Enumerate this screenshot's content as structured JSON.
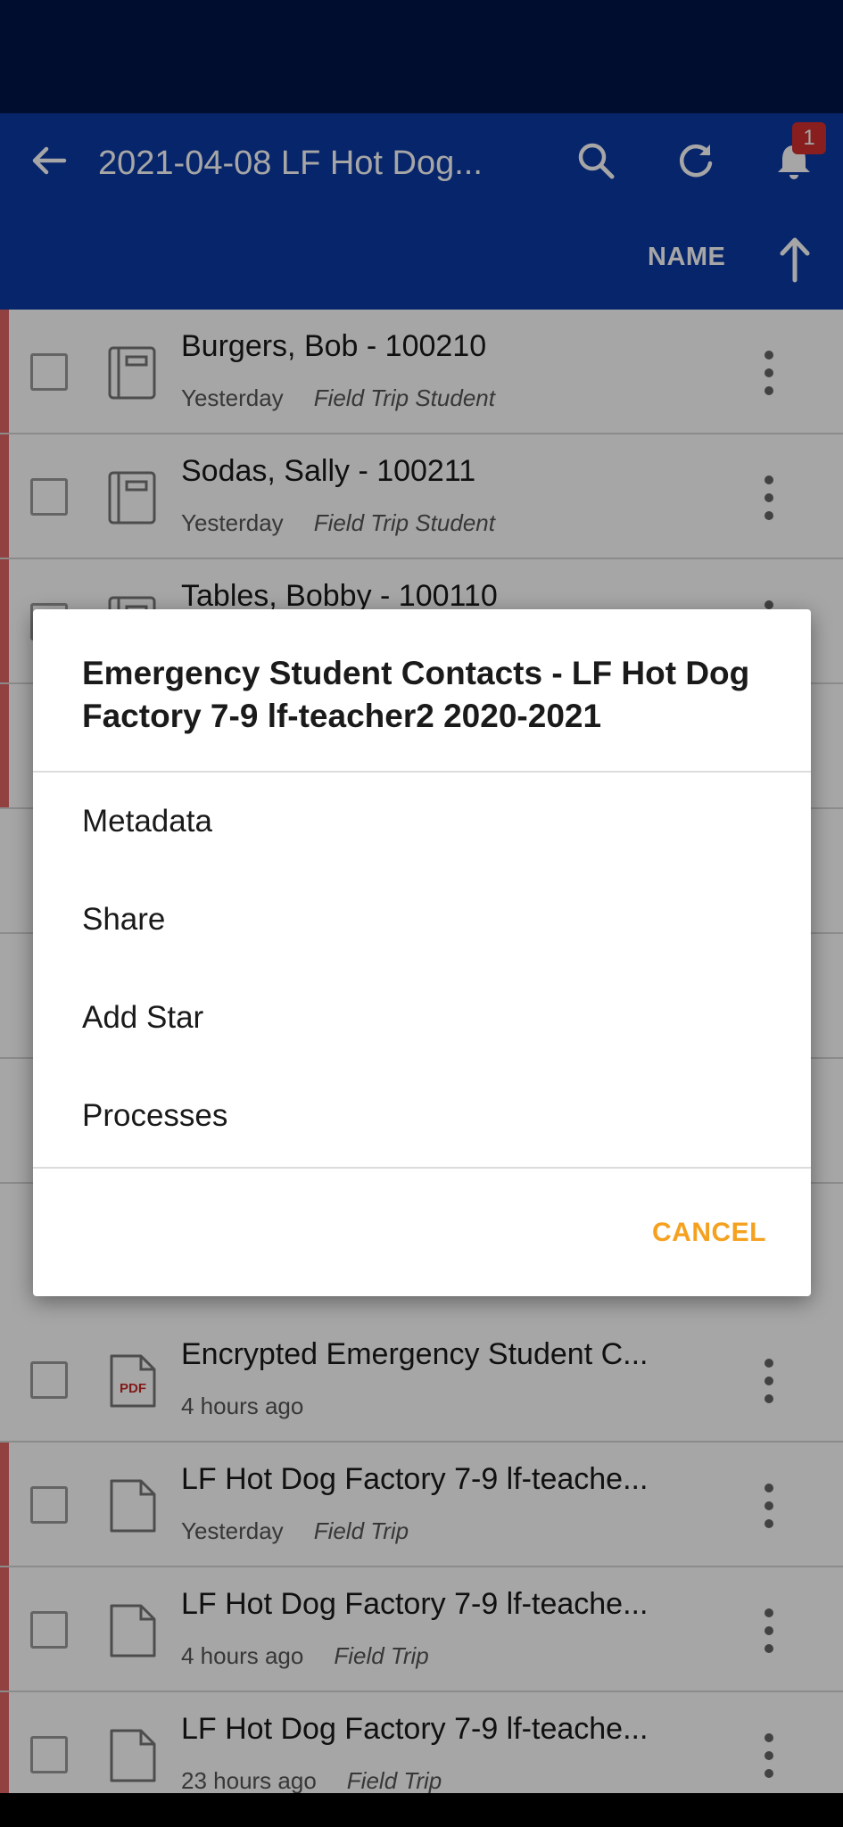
{
  "app_bar": {
    "title": "2021-04-08 LF Hot Dog...",
    "notification_count": "1",
    "sort_label": "NAME"
  },
  "list": {
    "rows": [
      {
        "name": "Burgers, Bob - 100210",
        "time": "Yesterday",
        "tag": "Field Trip Student",
        "icon": "form-icon"
      },
      {
        "name": "Sodas, Sally - 100211",
        "time": "Yesterday",
        "tag": "Field Trip Student",
        "icon": "form-icon"
      },
      {
        "name": "Tables, Bobby - 100110",
        "time": "",
        "tag": "",
        "icon": "form-icon"
      },
      {
        "name": "Encrypted Emergency Student C...",
        "time": "4 hours ago",
        "tag": "",
        "icon": "pdf-icon"
      },
      {
        "name": "LF Hot Dog Factory 7-9 lf-teache...",
        "time": "Yesterday",
        "tag": "Field Trip",
        "icon": "document-icon"
      },
      {
        "name": "LF Hot Dog Factory 7-9 lf-teache...",
        "time": "4 hours ago",
        "tag": "Field Trip",
        "icon": "document-icon"
      },
      {
        "name": "LF Hot Dog Factory 7-9 lf-teache...",
        "time": "23 hours ago",
        "tag": "Field Trip",
        "icon": "document-icon"
      }
    ]
  },
  "dialog": {
    "title": "Emergency Student Contacts - LF Hot Dog Factory 7-9 lf-teacher2 2020-2021",
    "items": [
      "Metadata",
      "Share",
      "Add Star",
      "Processes"
    ],
    "cancel_label": "CANCEL"
  },
  "colors": {
    "app_bar": "#0b3aa5",
    "status_bar": "#001447",
    "accent": "#f5a11f",
    "badge": "#d32f2f",
    "row_stripe": "#e06464"
  }
}
